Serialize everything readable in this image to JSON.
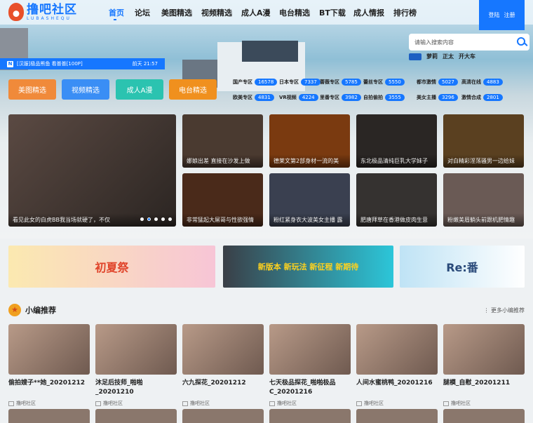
{
  "header": {
    "logo_text": "撸吧社区",
    "logo_sub": "LUBASHEQU",
    "nav": [
      "首页",
      "论坛",
      "美图精选",
      "视频精选",
      "成人A漫",
      "电台精选",
      "BT下载",
      "成人情报",
      "排行榜"
    ],
    "login": "登陆",
    "register": "注册"
  },
  "search": {
    "placeholder": "请输入搜索内容",
    "hot": [
      "萝莉",
      "正太",
      "开大车"
    ]
  },
  "notice": {
    "icon": "N",
    "text": "[汉服]极品熊鱼 看普普[100P]",
    "time": "前天 21:57"
  },
  "quick": [
    "美图精选",
    "视频精选",
    "成人A漫",
    "电台精选"
  ],
  "tags": [
    {
      "l": "国产专区",
      "n": "16578"
    },
    {
      "l": "日本专区",
      "n": "7337"
    },
    {
      "l": "蔷薇专区",
      "n": "5785"
    },
    {
      "l": "蕾丝专区",
      "n": "5550"
    },
    {
      "l": "都市激情",
      "n": "5027"
    },
    {
      "l": "高清在线",
      "n": "4883"
    },
    {
      "l": "欧美专区",
      "n": "4831"
    },
    {
      "l": "VR视频",
      "n": "4224"
    },
    {
      "l": "里番专区",
      "n": "3982"
    },
    {
      "l": "自拍偷拍",
      "n": "3555"
    },
    {
      "l": "美女主播",
      "n": "3296"
    },
    {
      "l": "激情合成",
      "n": "2801"
    }
  ],
  "slider": {
    "caption": "看见此女的白虎BB我当场就硬了，不仅",
    "count": 5,
    "active": 1
  },
  "grid": [
    "娜娘出差 直接在沙发上做",
    "德莱文第2部身材一流的美",
    "东北极品清纯巨乳大学妹子",
    "对白精彩淫荡骚男一边给妹",
    "非常猛起大屌哥与性欲强情",
    "粉红紧身衣大波美女主播 露",
    "肥唐拜草在香港做皮肉生意",
    "粉嫩美眉躺头前跟机肥情趣"
  ],
  "banners": [
    "初夏祭",
    "新版本 新玩法 新征程 新期待",
    "Re:番"
  ],
  "section": {
    "title": "小编推荐",
    "more": "更多小编推荐"
  },
  "cards": [
    {
      "t": "偷拍嫂子**她_20201212",
      "s": "撸吧社区"
    },
    {
      "t": "沐足后技师_啪啪_20201210",
      "s": "撸吧社区"
    },
    {
      "t": "六九探花_20201212",
      "s": "撸吧社区"
    },
    {
      "t": "七天极品探花_啪啪极品C_20201216",
      "s": "撸吧社区"
    },
    {
      "t": "人间水蜜桃鸭_20201216",
      "s": "撸吧社区"
    },
    {
      "t": "腿模_自慰_20201211",
      "s": "撸吧社区"
    }
  ]
}
